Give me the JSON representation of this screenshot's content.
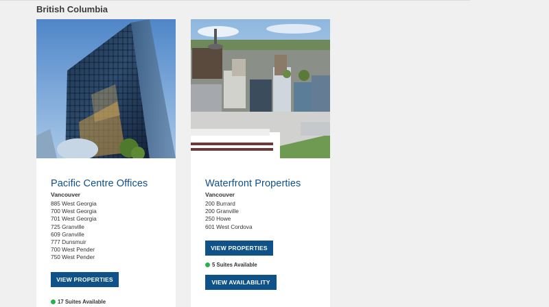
{
  "region": {
    "title": "British Columbia"
  },
  "cards": [
    {
      "image_icon": "office-tower-photo",
      "title": "Pacific Centre Offices",
      "city": "Vancouver",
      "addresses": [
        "885 West Georgia",
        "700 West Georgia",
        "701 West Georgia",
        "725 Granville",
        "609 Granville",
        "777 Dunsmuir",
        "700 West Pender",
        "750 West Pender"
      ],
      "view_properties_label": "VIEW PROPERTIES",
      "availability": "17 Suites Available"
    },
    {
      "image_icon": "waterfront-cityscape-photo",
      "title": "Waterfront Properties",
      "city": "Vancouver",
      "addresses": [
        "200 Burrard",
        "200 Granville",
        "250 Howe",
        "601 West Cordova"
      ],
      "view_properties_label": "VIEW PROPERTIES",
      "availability": "5 Suites Available",
      "view_availability_label": "VIEW AVAILABILITY"
    }
  ],
  "colors": {
    "accent": "#0e5289",
    "title": "#0e4f88",
    "available": "#27b24a",
    "background": "#f0f0f0"
  }
}
